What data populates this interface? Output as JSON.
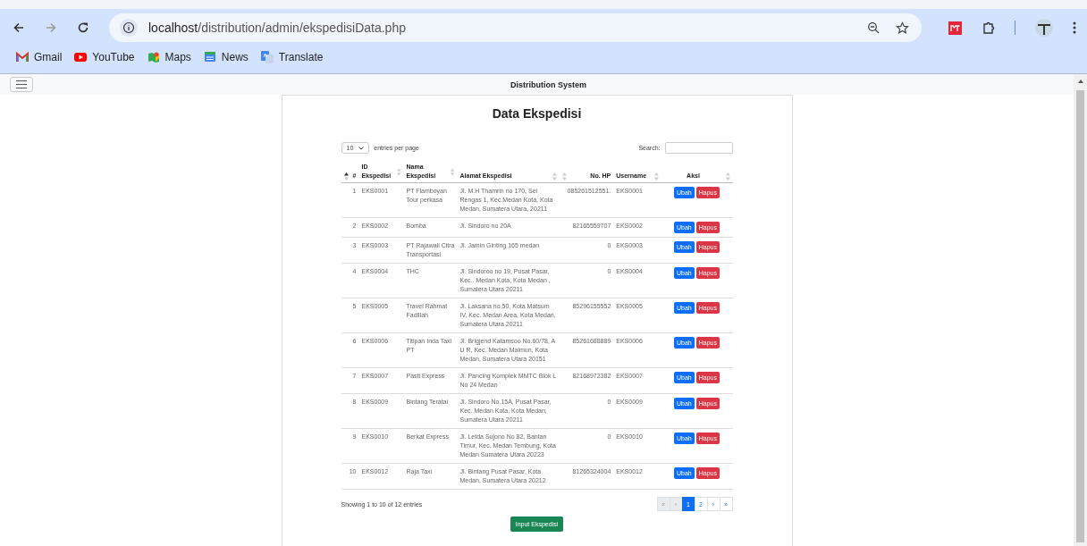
{
  "browser": {
    "url_host": "localhost",
    "url_path": "/distribution/admin/ekspedisiData.php",
    "bookmarks": [
      {
        "label": "Gmail",
        "kind": "gmail"
      },
      {
        "label": "YouTube",
        "kind": "youtube"
      },
      {
        "label": "Maps",
        "kind": "maps"
      },
      {
        "label": "News",
        "kind": "news"
      },
      {
        "label": "Translate",
        "kind": "translate"
      }
    ]
  },
  "navbar": {
    "title": "Distribution System"
  },
  "page": {
    "title": "Data Ekspedisi",
    "length": {
      "value": "10",
      "label": "entries per page"
    },
    "search": {
      "label": "Search:"
    },
    "table": {
      "columns": [
        {
          "label": "#",
          "sorted": true
        },
        {
          "label": "ID Ekspedisi",
          "sorted": false
        },
        {
          "label": "Nama Ekspedisi",
          "sorted": false
        },
        {
          "label": "Alamat Ekspedisi",
          "sorted": false
        },
        {
          "label": "No. HP",
          "sorted": false
        },
        {
          "label": "Username",
          "sorted": false
        },
        {
          "label": "Aksi",
          "sorted": false
        }
      ],
      "rows": [
        {
          "cells": [
            "1",
            "EKS0001",
            "PT Flamboyan Tour perkasa",
            "Jl. M.H Thamrin no 170, Sei Rengas 1, Kec.Medan Kota, Kota Medan, Sumatera Utara, 20211",
            "085261512551.",
            "EKS0001"
          ],
          "actions": [
            "Ubah",
            "Hapus"
          ]
        },
        {
          "cells": [
            "2",
            "EKS0002",
            "Bomba",
            "Jl. Sindoro no 20A",
            "82165559707",
            "EKS0002"
          ],
          "actions": [
            "Ubah",
            "Hapus"
          ]
        },
        {
          "cells": [
            "3",
            "EKS0003",
            "PT Rajawali Citra Transportasi",
            "Jl. Jamin Ginting 165 medan",
            "0",
            "EKS0003"
          ],
          "actions": [
            "Ubah",
            "Hapus"
          ]
        },
        {
          "cells": [
            "4",
            "EKS0004",
            "THC",
            "Jl. Sindoroo no 19, Pusat Pasar, Kec.. Medan Kota, Kota Medan , Sumatera Utara 20211",
            "0",
            "EKS0004"
          ],
          "actions": [
            "Ubah",
            "Hapus"
          ]
        },
        {
          "cells": [
            "5",
            "EKS0005",
            "Travel Rahmat Fadillah",
            "Jl. Laksana no.50, Kota Matsum IV, Kec. Medan Area, Kota Medan, Sumatera Utara 20211",
            "85296155552",
            "EKS0005"
          ],
          "actions": [
            "Ubah",
            "Hapus"
          ]
        },
        {
          "cells": [
            "6",
            "EKS0006",
            "Titipan Inda Taxi PT",
            "Jl. Brigjend Katamsoo No.60/78, A U R, Kec. Medan Maimun, Kota Medan, Sumatera Utara 20151",
            "85261688889",
            "EKS0006"
          ],
          "actions": [
            "Ubah",
            "Hapus"
          ]
        },
        {
          "cells": [
            "7",
            "EKS0007",
            "Pasti Express",
            "Jl. Pancing Komplek MMTC Blok L No 24 Medan",
            "82168972382",
            "EKS0007"
          ],
          "actions": [
            "Ubah",
            "Hapus"
          ]
        },
        {
          "cells": [
            "8",
            "EKS0009",
            "Bintang Teratai",
            "Jl. Sindoro No.15A, Pusat Pasar, Kec. Medan Kota, Kota Medan, Sumatera Utara 20211",
            "0",
            "EKS0009"
          ],
          "actions": [
            "Ubah",
            "Hapus"
          ]
        },
        {
          "cells": [
            "9",
            "EKS0010",
            "Berkat Express",
            "Jl. Letda Sujono No 82, Bantan Timur, Kec. Medan Tembung, Kota Medan Sumatera Utara 20223",
            "0",
            "EKS0010"
          ],
          "actions": [
            "Ubah",
            "Hapus"
          ]
        },
        {
          "cells": [
            "10",
            "EKS0012",
            "Raja Taxi",
            "Jl. Bintang Pusat Pasar, Kota Medan, Sumatera Utara 20212",
            "81265324004",
            "EKS0012"
          ],
          "actions": [
            "Ubah",
            "Hapus"
          ]
        }
      ]
    },
    "info": "Showing 1 to 10 of 12 entries",
    "pagination": [
      {
        "label": "«",
        "selected": false,
        "disabled": true
      },
      {
        "label": "‹",
        "selected": false,
        "disabled": true
      },
      {
        "label": "1",
        "selected": true,
        "disabled": false
      },
      {
        "label": "2",
        "selected": false,
        "disabled": false
      },
      {
        "label": "›",
        "selected": false,
        "disabled": false
      },
      {
        "label": "»",
        "selected": false,
        "disabled": false
      }
    ],
    "add_button": "Input Ekspedisi"
  }
}
